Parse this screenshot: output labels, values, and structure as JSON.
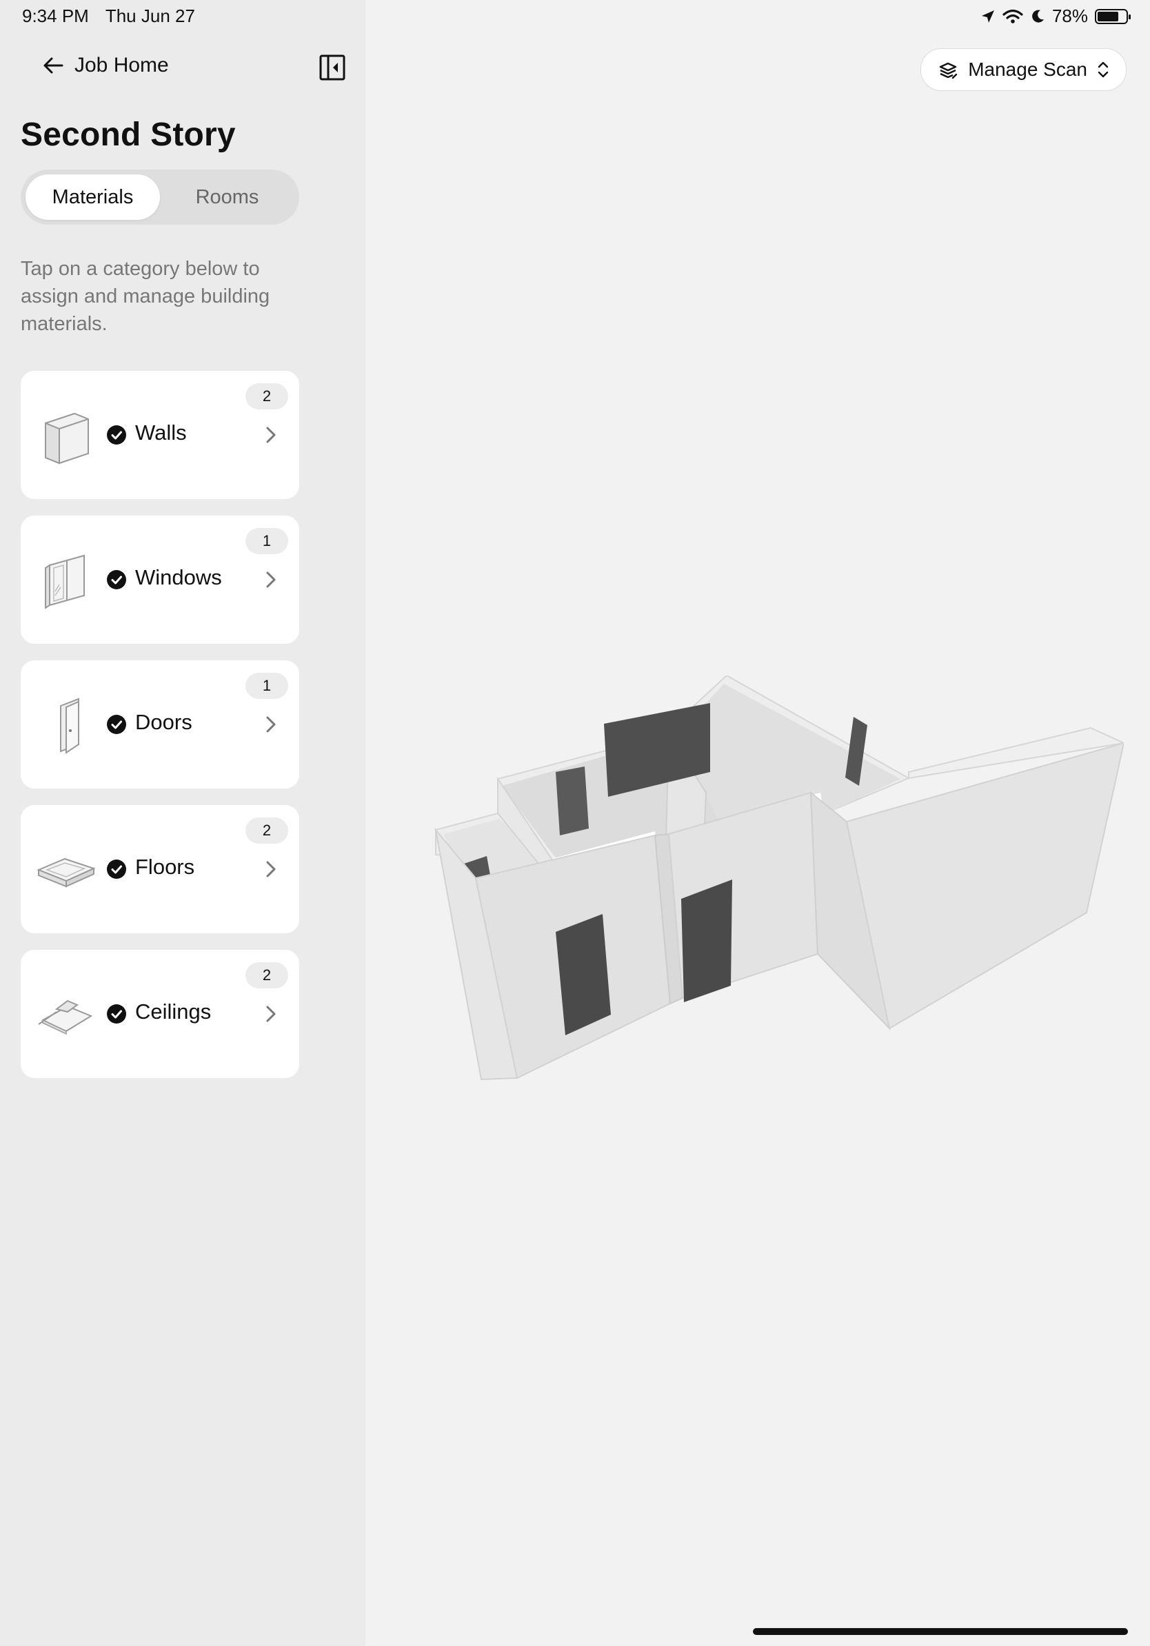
{
  "status_bar": {
    "time": "9:34 PM",
    "date": "Thu Jun 27",
    "battery": "78%",
    "battery_level": 0.78,
    "icons": [
      "location-icon",
      "wifi-icon",
      "moon-icon",
      "battery-icon"
    ]
  },
  "sidebar": {
    "back_label": "Job Home",
    "title": "Second Story",
    "segments": [
      {
        "label": "Materials",
        "active": true
      },
      {
        "label": "Rooms",
        "active": false
      }
    ],
    "instructions": "Tap on a category below to assign and manage building materials.",
    "categories": [
      {
        "label": "Walls",
        "count": "2",
        "icon": "wall-icon",
        "status": "check-icon"
      },
      {
        "label": "Windows",
        "count": "1",
        "icon": "window-icon",
        "status": "check-icon"
      },
      {
        "label": "Doors",
        "count": "1",
        "icon": "door-icon",
        "status": "check-icon"
      },
      {
        "label": "Floors",
        "count": "2",
        "icon": "floor-icon",
        "status": "check-icon"
      },
      {
        "label": "Ceilings",
        "count": "2",
        "icon": "ceiling-icon",
        "status": "check-icon"
      }
    ]
  },
  "main": {
    "manage_scan_label": "Manage Scan"
  },
  "colors": {
    "sidebar_bg": "#ebebeb",
    "main_bg": "#f2f2f2",
    "card_bg": "#ffffff",
    "text": "#111111",
    "muted": "#777777",
    "model_dark": "#4d4d4d",
    "model_light": "#e2e2e2"
  }
}
